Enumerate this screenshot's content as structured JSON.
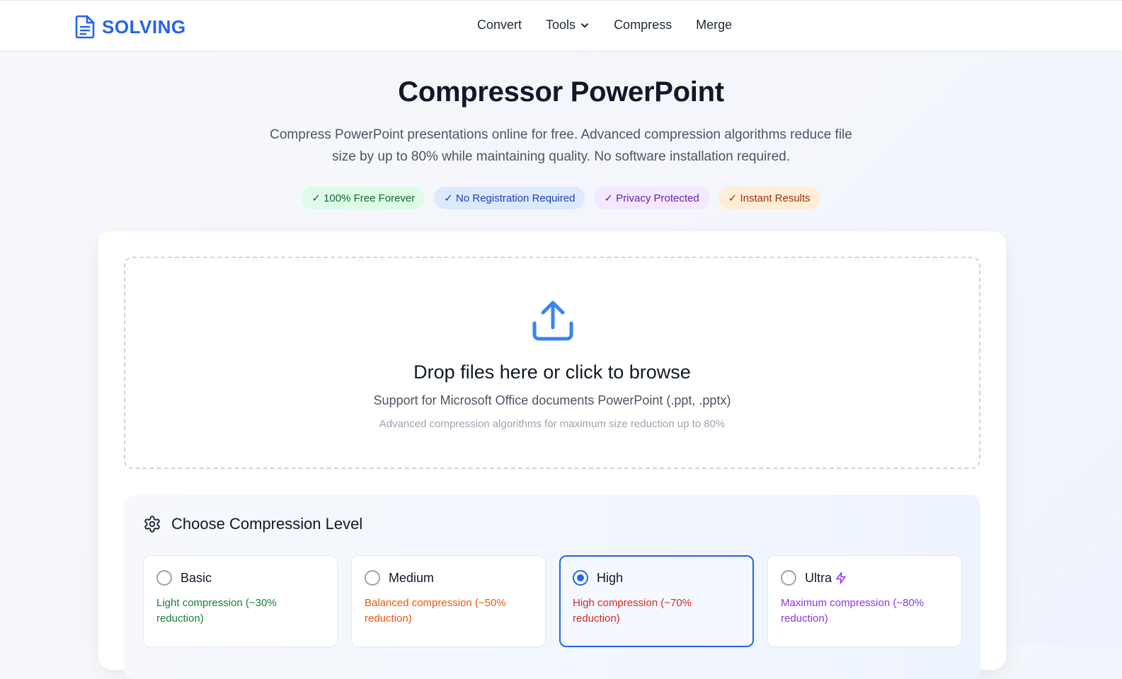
{
  "brand": {
    "name": "SOLVING",
    "color": "#2563eb",
    "icon": "document-icon"
  },
  "nav": {
    "items": [
      {
        "label": "Convert"
      },
      {
        "label": "Tools",
        "has_dropdown": true
      },
      {
        "label": "Compress"
      },
      {
        "label": "Merge"
      }
    ]
  },
  "hero": {
    "title": "Compressor PowerPoint",
    "subtitle": "Compress PowerPoint presentations online for free. Advanced compression algorithms reduce file size by up to 80% while maintaining quality. No software installation required.",
    "badges": [
      {
        "label": "✓ 100% Free Forever",
        "color": "#166534"
      },
      {
        "label": "✓ No Registration Required",
        "color": "#1e40af"
      },
      {
        "label": "✓ Privacy Protected",
        "color": "#6b21a8"
      },
      {
        "label": "✓ Instant Results",
        "color": "#9a3412"
      }
    ]
  },
  "dropzone": {
    "icon": "upload-icon",
    "title": "Drop files here or click to browse",
    "subtitle": "Support for Microsoft Office documents PowerPoint (.ppt, .pptx)",
    "note": "Advanced compression algorithms for maximum size reduction up to 80%"
  },
  "compression": {
    "icon": "gear-icon",
    "title": "Choose Compression Level",
    "selected": "High",
    "options": [
      {
        "name": "Basic",
        "description": "Light compression (~30% reduction)",
        "color": "#15803d"
      },
      {
        "name": "Medium",
        "description": "Balanced compression (~50% reduction)",
        "color": "#ea580c"
      },
      {
        "name": "High",
        "description": "High compression (~70% reduction)",
        "color": "#dc2626"
      },
      {
        "name": "Ultra",
        "description": "Maximum compression (~80% reduction)",
        "color": "#9333ea",
        "icon": "lightning-icon"
      }
    ]
  }
}
